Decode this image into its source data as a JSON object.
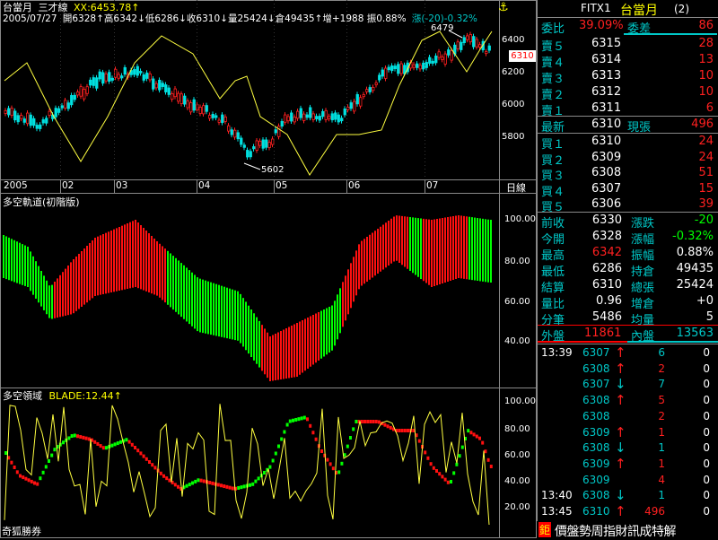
{
  "colors": {
    "up": "#ff2020",
    "down": "#00e0e0",
    "line": "#ffff40",
    "bull": "#00ff00",
    "bear": "#ff1010"
  },
  "price_panel": {
    "title": "台當月",
    "indicator_label": "三才線",
    "xx_label": "XX:6453.78↑",
    "date": "2005/07/27",
    "stats": "開6328↑高6342↓低6286↓收6310↓量25424↓倉49435↑增+1988 振0.88%",
    "change": "漲(-20)-0.32%",
    "y_ticks": [
      "6400",
      "6200",
      "6000",
      "5800"
    ],
    "price_tag": "6310",
    "high_marker": "6479",
    "low_marker": "5602",
    "x_labels": [
      "2005",
      "02",
      "03",
      "04",
      "05",
      "06",
      "07"
    ],
    "period_label": "日線"
  },
  "track_panel": {
    "title": "多空軌道(初階版)",
    "y_ticks": [
      "100.00",
      "80.00",
      "60.00",
      "40.00"
    ]
  },
  "domain_panel": {
    "title": "多空領域",
    "blade_label": "BLADE:12.44↑",
    "y_ticks": [
      "100.00",
      "80.00",
      "60.00",
      "40.00",
      "20.00"
    ],
    "footer": "奇狐勝券"
  },
  "quote": {
    "code": "FITX1",
    "name": "台當月",
    "tab": "(2)",
    "ratio": {
      "label": "委比",
      "value": "39.09%",
      "diff_label": "委差",
      "diff": "86"
    },
    "asks": [
      {
        "label": "賣５",
        "price": "6315",
        "qty": "28"
      },
      {
        "label": "賣４",
        "price": "6314",
        "qty": "13"
      },
      {
        "label": "賣３",
        "price": "6313",
        "qty": "10"
      },
      {
        "label": "賣２",
        "price": "6312",
        "qty": "10"
      },
      {
        "label": "賣１",
        "price": "6311",
        "qty": "6"
      }
    ],
    "latest": {
      "label": "最新",
      "price": "6310",
      "qty_label": "現張",
      "qty": "496"
    },
    "bids": [
      {
        "label": "買１",
        "price": "6310",
        "qty": "24"
      },
      {
        "label": "買２",
        "price": "6309",
        "qty": "24"
      },
      {
        "label": "買３",
        "price": "6308",
        "qty": "51"
      },
      {
        "label": "買４",
        "price": "6307",
        "qty": "15"
      },
      {
        "label": "買５",
        "price": "6306",
        "qty": "39"
      }
    ],
    "stats": [
      {
        "l1": "前收",
        "v1": "6330",
        "l2": "漲跌",
        "v2": "-20",
        "c1": "wht",
        "c2": "grn"
      },
      {
        "l1": "今開",
        "v1": "6328",
        "l2": "漲幅",
        "v2": "-0.32%",
        "c1": "wht",
        "c2": "grn"
      },
      {
        "l1": "最高",
        "v1": "6342",
        "l2": "振幅",
        "v2": "0.88%",
        "c1": "red",
        "c2": "wht"
      },
      {
        "l1": "最低",
        "v1": "6286",
        "l2": "持倉",
        "v2": "49435",
        "c1": "wht",
        "c2": "wht"
      },
      {
        "l1": "結算",
        "v1": "6310",
        "l2": "總張",
        "v2": "25424",
        "c1": "wht",
        "c2": "wht"
      },
      {
        "l1": "量比",
        "v1": "0.96",
        "l2": "增倉",
        "v2": "+0",
        "c1": "wht",
        "c2": "wht"
      },
      {
        "l1": "分筆",
        "v1": "5486",
        "l2": "均量",
        "v2": "5",
        "c1": "wht",
        "c2": "wht"
      }
    ],
    "outer": {
      "label": "外盤",
      "value": "11861"
    },
    "inner": {
      "label": "內盤",
      "value": "13563"
    },
    "ticks": [
      {
        "time": "13:39",
        "price": "6307",
        "dir": "↑",
        "qty": "6",
        "z": "0",
        "pc": "cyan",
        "dc": "red",
        "qc": "cyan"
      },
      {
        "time": "",
        "price": "6308",
        "dir": "↑",
        "qty": "2",
        "z": "0",
        "pc": "cyan",
        "dc": "red",
        "qc": "red"
      },
      {
        "time": "",
        "price": "6307",
        "dir": "↓",
        "qty": "7",
        "z": "0",
        "pc": "cyan",
        "dc": "cyan",
        "qc": "cyan"
      },
      {
        "time": "",
        "price": "6308",
        "dir": "↑",
        "qty": "5",
        "z": "0",
        "pc": "cyan",
        "dc": "red",
        "qc": "red"
      },
      {
        "time": "",
        "price": "6308",
        "dir": "",
        "qty": "2",
        "z": "0",
        "pc": "cyan",
        "dc": "red",
        "qc": "red"
      },
      {
        "time": "",
        "price": "6309",
        "dir": "↑",
        "qty": "1",
        "z": "0",
        "pc": "cyan",
        "dc": "red",
        "qc": "red"
      },
      {
        "time": "",
        "price": "6308",
        "dir": "↓",
        "qty": "1",
        "z": "0",
        "pc": "cyan",
        "dc": "cyan",
        "qc": "cyan"
      },
      {
        "time": "",
        "price": "6309",
        "dir": "↑",
        "qty": "1",
        "z": "0",
        "pc": "cyan",
        "dc": "red",
        "qc": "red"
      },
      {
        "time": "",
        "price": "6309",
        "dir": "",
        "qty": "4",
        "z": "0",
        "pc": "cyan",
        "dc": "red",
        "qc": "red"
      },
      {
        "time": "13:40",
        "price": "6308",
        "dir": "↓",
        "qty": "1",
        "z": "0",
        "pc": "cyan",
        "dc": "cyan",
        "qc": "cyan"
      },
      {
        "time": "13:45",
        "price": "6310",
        "dir": "↑",
        "qty": "496",
        "z": "0",
        "pc": "cyan",
        "dc": "red",
        "qc": "red"
      }
    ],
    "ticker_badge": "鉅",
    "ticker": "價盤勢周指財訊成特解"
  }
}
